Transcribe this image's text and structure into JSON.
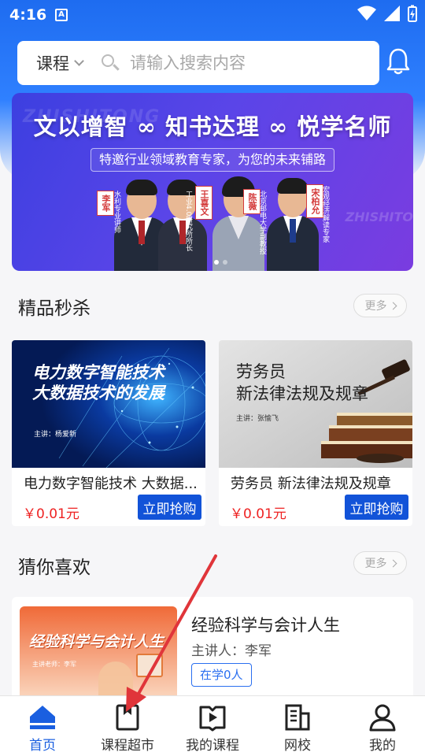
{
  "status_bar": {
    "time": "4:16",
    "indicator": "A"
  },
  "search": {
    "category": "课程",
    "placeholder": "请输入搜索内容"
  },
  "banner": {
    "watermark": "ZHISHITONG",
    "watermark2": "ZHISHITO",
    "title": "文以增智 ∞ 知书达理 ∞ 悦学名师",
    "subtitle": "特邀行业领域教育专家，为您的未来铺路",
    "people": [
      {
        "name": "李军",
        "role": "水利专业讲师"
      },
      {
        "name": "王喜文",
        "role": "工业4.0研究所所长"
      },
      {
        "name": "陈薇",
        "role": "北京邮电大学副教授"
      },
      {
        "name": "宋柏允",
        "role": "宏观经济解读专家"
      }
    ]
  },
  "flash_sale": {
    "title": "精品秒杀",
    "more": "更多",
    "items": [
      {
        "cover_line1": "电力数字智能技术",
        "cover_line2": "大数据技术的发展",
        "cover_lecturer": "主讲：杨爱新",
        "name": "电力数字智能技术 大数据...",
        "price": "￥0.01元",
        "button": "立即抢购"
      },
      {
        "cover_line1": "劳务员",
        "cover_line2": "新法律法规及规章",
        "cover_lecturer": "主讲：张愉飞",
        "name": "劳务员 新法律法规及规章",
        "price": "￥0.01元",
        "button": "立即抢购"
      }
    ]
  },
  "guess": {
    "title": "猜你喜欢",
    "more": "更多",
    "items": [
      {
        "cover_title": "经验科学与会计人生",
        "cover_lecturer": "主讲老师：李军",
        "title": "经验科学与会计人生",
        "teacher": "主讲人：李军",
        "tag": "在学0人"
      }
    ]
  },
  "bottom_nav": [
    {
      "label": "首页",
      "icon": "home-icon",
      "active": true
    },
    {
      "label": "课程超市",
      "icon": "course-market-icon",
      "active": false
    },
    {
      "label": "我的课程",
      "icon": "my-course-icon",
      "active": false
    },
    {
      "label": "网校",
      "icon": "school-icon",
      "active": false
    },
    {
      "label": "我的",
      "icon": "profile-icon",
      "active": false
    }
  ],
  "colors": {
    "primary": "#1a5fe0",
    "header": "#2f80ff",
    "price": "#e22222",
    "annotation_arrow": "#e0353a"
  }
}
